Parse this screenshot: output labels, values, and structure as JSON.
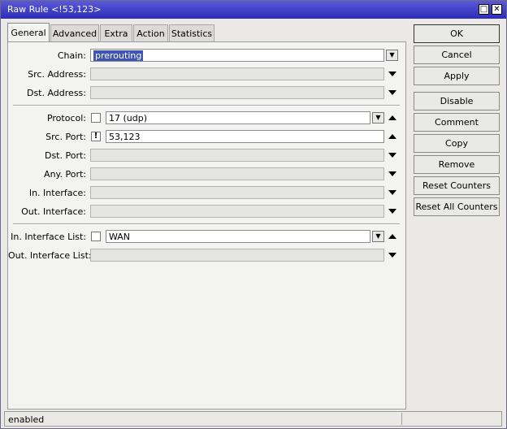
{
  "window": {
    "title": "Raw Rule <!53,123>",
    "minimize_glyph": "□",
    "close_glyph": "✕"
  },
  "tabs": [
    {
      "label": "General",
      "active": true
    },
    {
      "label": "Advanced"
    },
    {
      "label": "Extra"
    },
    {
      "label": "Action"
    },
    {
      "label": "Statistics"
    }
  ],
  "form": {
    "chain": {
      "label": "Chain:",
      "value": "prerouting"
    },
    "src_address": {
      "label": "Src. Address:",
      "value": ""
    },
    "dst_address": {
      "label": "Dst. Address:",
      "value": ""
    },
    "protocol": {
      "label": "Protocol:",
      "value": "17 (udp)",
      "negate": false
    },
    "src_port": {
      "label": "Src. Port:",
      "value": "53,123",
      "negate": true,
      "negate_glyph": "!"
    },
    "dst_port": {
      "label": "Dst. Port:",
      "value": ""
    },
    "any_port": {
      "label": "Any. Port:",
      "value": ""
    },
    "in_interface": {
      "label": "In. Interface:",
      "value": ""
    },
    "out_interface": {
      "label": "Out. Interface:",
      "value": ""
    },
    "in_interface_list": {
      "label": "In. Interface List:",
      "value": "WAN",
      "negate": false
    },
    "out_interface_list": {
      "label": "Out. Interface List:",
      "value": ""
    }
  },
  "buttons": {
    "ok": "OK",
    "cancel": "Cancel",
    "apply": "Apply",
    "disable": "Disable",
    "comment": "Comment",
    "copy": "Copy",
    "remove": "Remove",
    "reset_counters": "Reset Counters",
    "reset_all_counters": "Reset All Counters"
  },
  "status": {
    "text": "enabled"
  },
  "icons": {
    "dropdown_glyph": "▼"
  }
}
